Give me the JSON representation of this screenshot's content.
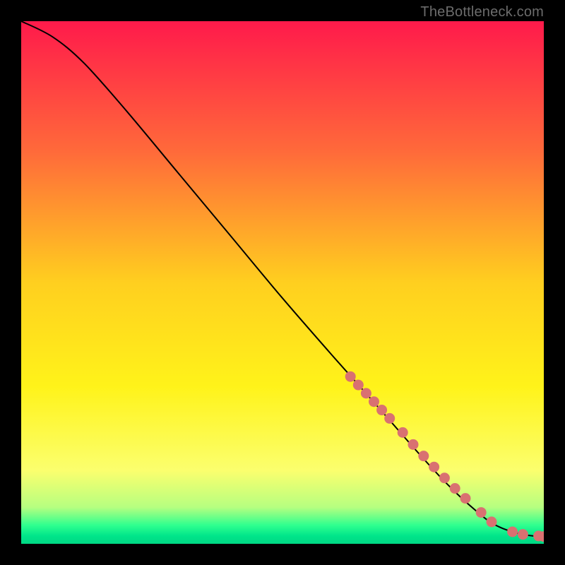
{
  "attribution": "TheBottleneck.com",
  "colors": {
    "frame_bg": "#000000",
    "line": "#000000",
    "marker_fill": "#d97171",
    "gradient_stops": [
      {
        "offset": 0.0,
        "color": "#ff1a4b"
      },
      {
        "offset": 0.25,
        "color": "#ff6a3a"
      },
      {
        "offset": 0.5,
        "color": "#ffcf1f"
      },
      {
        "offset": 0.7,
        "color": "#fff31a"
      },
      {
        "offset": 0.86,
        "color": "#fbff6e"
      },
      {
        "offset": 0.93,
        "color": "#b6ff80"
      },
      {
        "offset": 0.965,
        "color": "#2dff8f"
      },
      {
        "offset": 0.985,
        "color": "#00e58a"
      },
      {
        "offset": 1.0,
        "color": "#00d884"
      }
    ]
  },
  "chart_data": {
    "type": "line",
    "title": "",
    "xlabel": "",
    "ylabel": "",
    "xlim": [
      0,
      100
    ],
    "ylim": [
      0,
      100
    ],
    "grid": false,
    "legend": false,
    "series": [
      {
        "name": "curve",
        "style": "line",
        "x": [
          0,
          6,
          12,
          20,
          30,
          40,
          50,
          60,
          68,
          75,
          80,
          84,
          88,
          90,
          92,
          94,
          96,
          98,
          100
        ],
        "y": [
          100,
          97,
          92,
          83,
          71,
          59,
          47,
          35.5,
          26.5,
          18.5,
          13,
          9,
          5.5,
          4,
          3,
          2.3,
          1.8,
          1.5,
          1.4
        ]
      },
      {
        "name": "highlighted-points",
        "style": "markers",
        "x": [
          63,
          64.5,
          66,
          67.5,
          69,
          70.5,
          73,
          75,
          77,
          79,
          81,
          83,
          85,
          88,
          90,
          94,
          96,
          99,
          100
        ],
        "y": [
          32,
          30.4,
          28.8,
          27.2,
          25.6,
          24,
          21.3,
          19,
          16.8,
          14.7,
          12.6,
          10.6,
          8.7,
          6,
          4.2,
          2.3,
          1.8,
          1.5,
          1.4
        ]
      }
    ]
  }
}
